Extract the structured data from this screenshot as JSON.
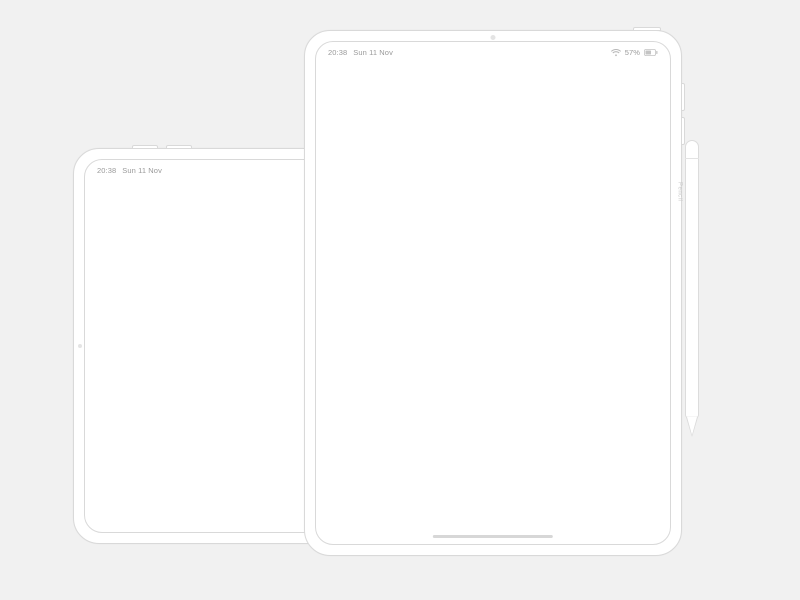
{
  "small_tablet": {
    "status": {
      "time": "20:38",
      "date": "Sun 11 Nov"
    }
  },
  "large_tablet": {
    "status": {
      "time": "20:38",
      "date": "Sun 11 Nov",
      "battery_pct": "57%"
    }
  },
  "pencil": {
    "brand_glyph": "",
    "label": "Pencil"
  }
}
